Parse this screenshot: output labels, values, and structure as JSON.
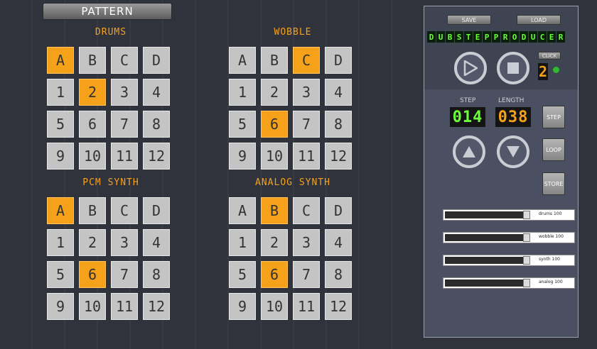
{
  "header": {
    "pattern_label": "PATTERN"
  },
  "groups": [
    {
      "title": "DRUMS",
      "letters": [
        "A",
        "B",
        "C",
        "D"
      ],
      "active_letter": "A",
      "numbers": [
        "1",
        "2",
        "3",
        "4",
        "5",
        "6",
        "7",
        "8",
        "9",
        "10",
        "11",
        "12"
      ],
      "active_number": "2"
    },
    {
      "title": "WOBBLE",
      "letters": [
        "A",
        "B",
        "C",
        "D"
      ],
      "active_letter": "C",
      "numbers": [
        "1",
        "2",
        "3",
        "4",
        "5",
        "6",
        "7",
        "8",
        "9",
        "10",
        "11",
        "12"
      ],
      "active_number": "6"
    },
    {
      "title": "PCM SYNTH",
      "letters": [
        "A",
        "B",
        "C",
        "D"
      ],
      "active_letter": "A",
      "numbers": [
        "1",
        "2",
        "3",
        "4",
        "5",
        "6",
        "7",
        "8",
        "9",
        "10",
        "11",
        "12"
      ],
      "active_number": "6"
    },
    {
      "title": "ANALOG SYNTH",
      "letters": [
        "A",
        "B",
        "C",
        "D"
      ],
      "active_letter": "B",
      "numbers": [
        "1",
        "2",
        "3",
        "4",
        "5",
        "6",
        "7",
        "8",
        "9",
        "10",
        "11",
        "12"
      ],
      "active_number": "6"
    }
  ],
  "panel": {
    "save_label": "SAVE",
    "load_label": "LOAD",
    "app_name": "DUBSTEPPRODUCER",
    "click_label": "CLICK",
    "click_value": "2",
    "step_label": "STEP",
    "length_label": "LENGTH",
    "step_value": "014",
    "length_value": "038",
    "step_button": "STEP",
    "loop_button": "LOOP",
    "store_button": "STORE",
    "sliders": [
      {
        "label": "drums 100",
        "level": 1.0
      },
      {
        "label": "wobble 100",
        "level": 1.0
      },
      {
        "label": "synth 100",
        "level": 1.0
      },
      {
        "label": "analog 100",
        "level": 1.0
      }
    ],
    "colors": {
      "led_green": "#6aff3a",
      "accent_orange": "#f5a11a"
    }
  }
}
